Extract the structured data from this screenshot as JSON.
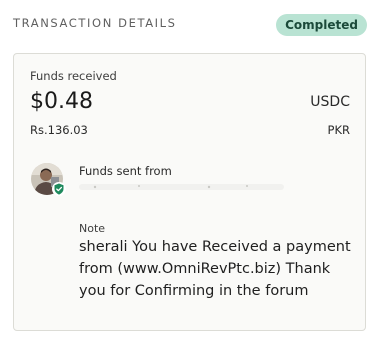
{
  "header": {
    "title": "TRANSACTION DETAILS",
    "status": "Completed"
  },
  "colors": {
    "status_badge_bg": "#b9e3d3",
    "status_badge_text": "#1b4a3a",
    "card_border": "#dcdcd6",
    "verified_badge": "#1f8a5e"
  },
  "funds": {
    "label": "Funds received",
    "amount": "$0.48",
    "currency": "USDC",
    "local_amount": "Rs.136.03",
    "local_currency": "PKR"
  },
  "sender": {
    "label": "Funds sent from",
    "avatar_icon": "user-avatar",
    "verified_icon": "shield-check-icon"
  },
  "note": {
    "label": "Note",
    "text": "sherali You have Received a payment from (www.OmniRevPtc.biz) Thank you for Confirming in the forum"
  }
}
